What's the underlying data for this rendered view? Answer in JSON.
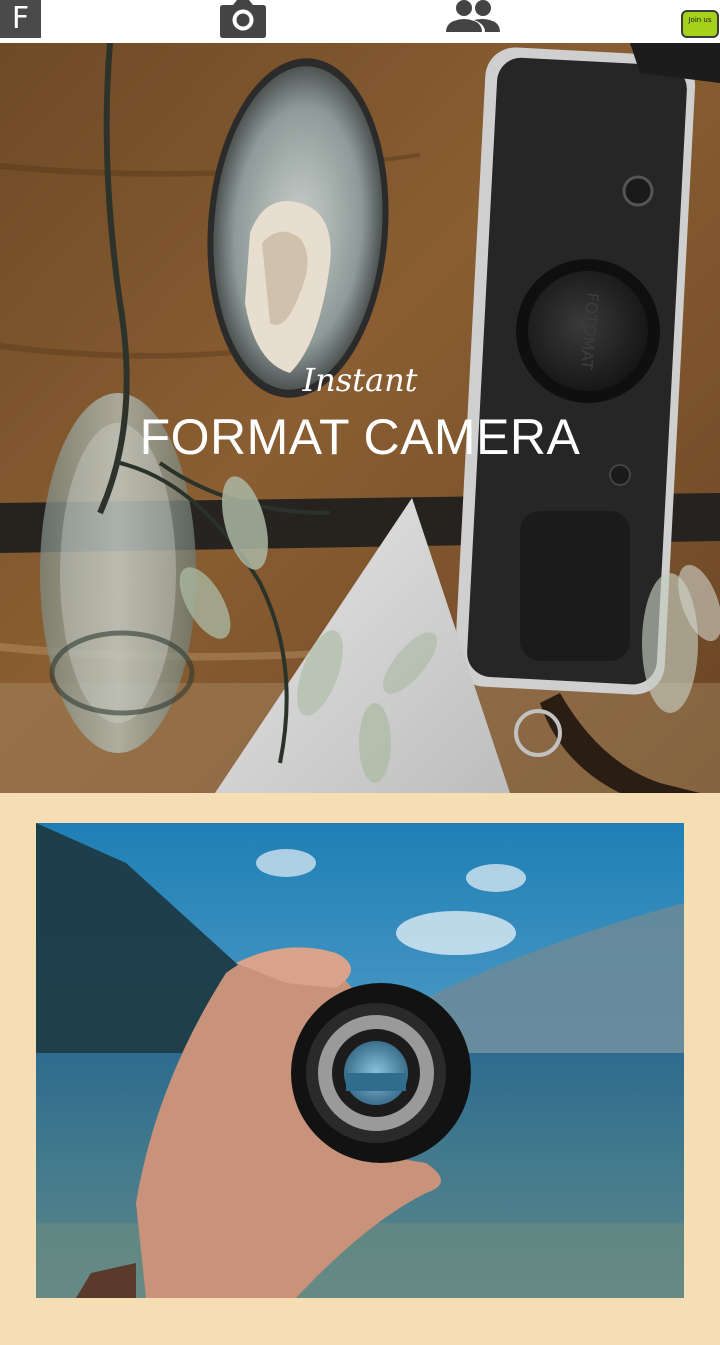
{
  "header": {
    "logo_letter": "F",
    "join_label": "Join us",
    "icons": [
      "camera-icon",
      "people-icon"
    ]
  },
  "hero": {
    "subtitle": "Instant",
    "title": "FORMAT CAMERA",
    "lens_cap_text": "FOTOMAT"
  },
  "colors": {
    "page_background": "#f5deb3",
    "join_button": "#a6d11a",
    "logo_background": "#4a4a4a",
    "hero_text": "#ffffff"
  }
}
